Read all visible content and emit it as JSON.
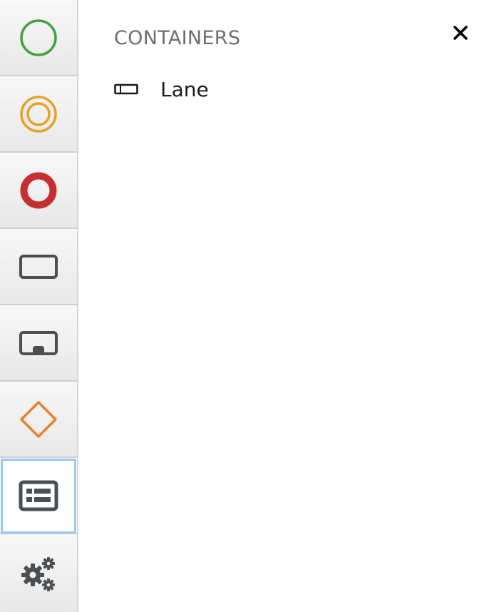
{
  "toolbar": {
    "items": [
      {
        "name": "start-events",
        "icon": "circle-thin-icon",
        "color": "#43a140"
      },
      {
        "name": "intermediate-events",
        "icon": "double-circle-icon",
        "color": "#e8a126"
      },
      {
        "name": "end-events",
        "icon": "circle-thick-icon",
        "color": "#c62f32"
      },
      {
        "name": "activities",
        "icon": "rounded-rect-icon",
        "color": "#4a4f54"
      },
      {
        "name": "subprocesses",
        "icon": "subprocess-rect-icon",
        "color": "#4a4f54"
      },
      {
        "name": "gateways",
        "icon": "diamond-icon",
        "color": "#e7822b"
      },
      {
        "name": "containers",
        "icon": "form-list-icon",
        "color": "#4a4f54",
        "active": true
      },
      {
        "name": "service-tasks",
        "icon": "gears-icon",
        "color": "#4a4f54"
      }
    ]
  },
  "panel": {
    "title": "CONTAINERS",
    "close_icon": "close-icon",
    "items": [
      {
        "label": "Lane",
        "icon": "lane-icon"
      }
    ]
  }
}
